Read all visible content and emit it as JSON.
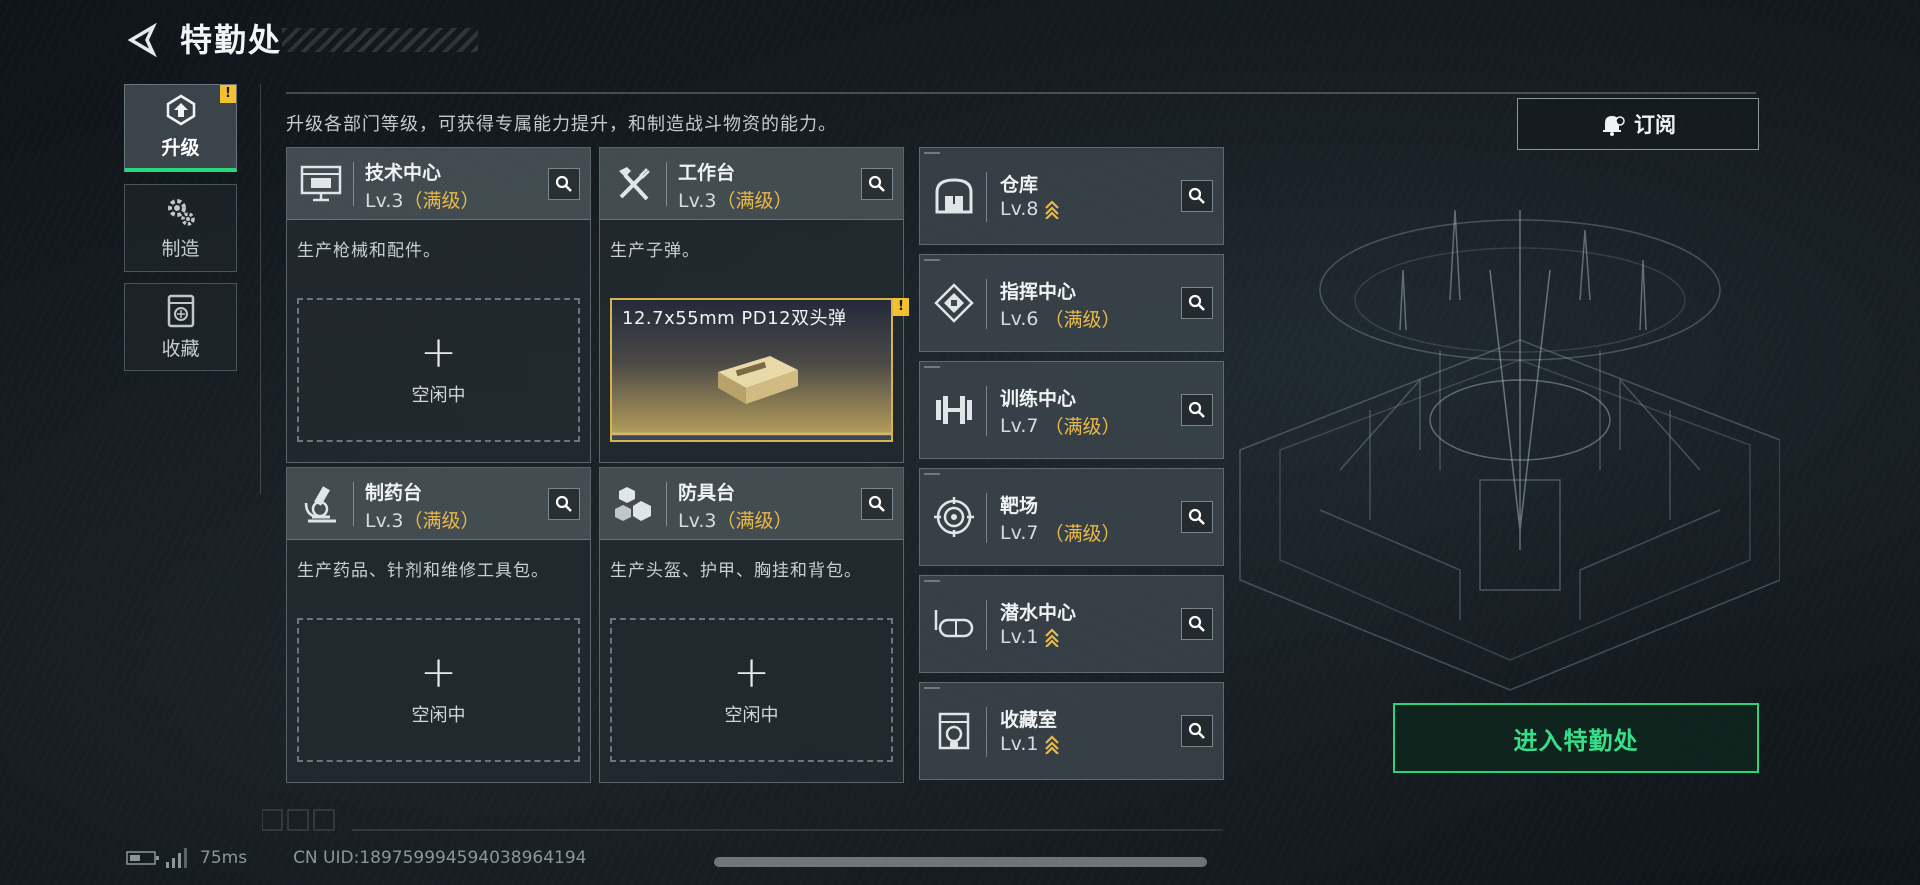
{
  "header": {
    "title": "特勤处"
  },
  "sidebar": {
    "tabs": [
      {
        "label": "升级",
        "active": true,
        "warning": "!"
      },
      {
        "label": "制造",
        "active": false
      },
      {
        "label": "收藏",
        "active": false
      }
    ]
  },
  "subtitle": "升级各部门等级，可获得专属能力提升，和制造战斗物资的能力。",
  "subscribe": {
    "label": "订阅",
    "icon": "bell-icon"
  },
  "workshops": [
    {
      "name": "技术中心",
      "level": "Lv.3",
      "max": "（满级）",
      "desc": "生产枪械和配件。",
      "slot": "空闲中",
      "icon": "monitor-icon"
    },
    {
      "name": "工作台",
      "level": "Lv.3",
      "max": "（满级）",
      "desc": "生产子弹。",
      "slot_item": "12.7x55mm PD12双头弹",
      "slot_warning": "!",
      "icon": "tools-icon"
    },
    {
      "name": "制药台",
      "level": "Lv.3",
      "max": "（满级）",
      "desc": "生产药品、针剂和维修工具包。",
      "slot": "空闲中",
      "icon": "microscope-icon"
    },
    {
      "name": "防具台",
      "level": "Lv.3",
      "max": "（满级）",
      "desc": "生产头盔、护甲、胸挂和背包。",
      "slot": "空闲中",
      "icon": "cubes-icon"
    }
  ],
  "facilities": [
    {
      "name": "仓库",
      "level": "Lv.8",
      "upgradable": true,
      "icon": "warehouse-icon"
    },
    {
      "name": "指挥中心",
      "level": "Lv.6",
      "max": "（满级）",
      "icon": "command-icon"
    },
    {
      "name": "训练中心",
      "level": "Lv.7",
      "max": "（满级）",
      "icon": "dumbbell-icon"
    },
    {
      "name": "靶场",
      "level": "Lv.7",
      "max": "（满级）",
      "icon": "target-icon"
    },
    {
      "name": "潜水中心",
      "level": "Lv.1",
      "upgradable": true,
      "icon": "diving-mask-icon"
    },
    {
      "name": "收藏室",
      "level": "Lv.1",
      "upgradable": true,
      "icon": "collection-icon"
    }
  ],
  "enter_button": "进入特勤处",
  "status": {
    "ping": "75ms",
    "uid": "CN UID:18975999459403896419​4"
  },
  "colors": {
    "accent_green": "#27d97a",
    "max_gold": "#e9b949",
    "warning_yellow": "#f2c12e"
  }
}
